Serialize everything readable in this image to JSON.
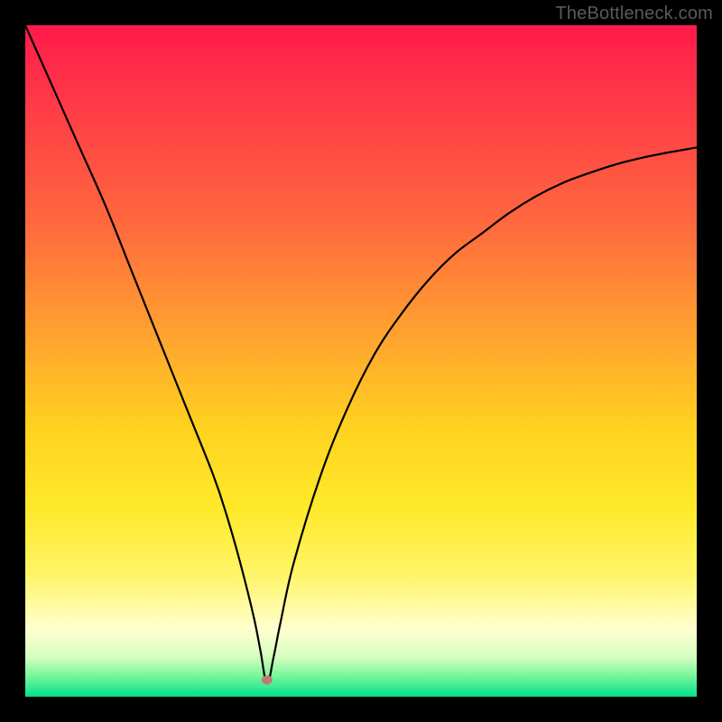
{
  "watermark": "TheBottleneck.com",
  "chart_data": {
    "type": "line",
    "title": "",
    "xlabel": "",
    "ylabel": "",
    "xlim": [
      0,
      100
    ],
    "ylim": [
      0,
      100
    ],
    "grid": false,
    "marker": {
      "x": 36,
      "y": 2.5,
      "color": "#c17a6f"
    },
    "series": [
      {
        "name": "bottleneck-curve",
        "x": [
          0,
          4,
          8,
          12,
          16,
          20,
          24,
          28,
          30,
          32,
          34,
          35,
          36,
          37,
          38,
          40,
          44,
          48,
          52,
          56,
          60,
          64,
          68,
          72,
          76,
          80,
          84,
          88,
          92,
          96,
          100
        ],
        "values": [
          100,
          91,
          82,
          73,
          63,
          53,
          43,
          33,
          27,
          20,
          12,
          7,
          2,
          6,
          11,
          20,
          33,
          43,
          51,
          57,
          62,
          66,
          69,
          72,
          74.5,
          76.5,
          78,
          79.3,
          80.3,
          81.1,
          81.8
        ]
      }
    ]
  }
}
